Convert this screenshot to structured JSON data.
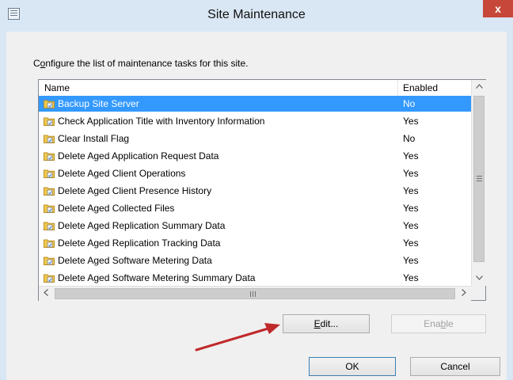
{
  "window": {
    "title": "Site Maintenance",
    "close_label": "x",
    "icon": "dialog-icon"
  },
  "instruction": {
    "accel": "o",
    "prefix": "C",
    "rest": "nfigure the list of maintenance tasks for this site."
  },
  "list": {
    "columns": {
      "name": "Name",
      "enabled": "Enabled"
    },
    "rows": [
      {
        "name": "Backup Site Server",
        "enabled": "No",
        "selected": true
      },
      {
        "name": "Check Application Title with Inventory Information",
        "enabled": "Yes"
      },
      {
        "name": "Clear Install Flag",
        "enabled": "No"
      },
      {
        "name": "Delete Aged Application Request Data",
        "enabled": "Yes"
      },
      {
        "name": "Delete Aged Client Operations",
        "enabled": "Yes"
      },
      {
        "name": "Delete Aged Client Presence History",
        "enabled": "Yes"
      },
      {
        "name": "Delete Aged Collected Files",
        "enabled": "Yes"
      },
      {
        "name": "Delete Aged Replication Summary Data",
        "enabled": "Yes"
      },
      {
        "name": "Delete Aged Replication Tracking Data",
        "enabled": "Yes"
      },
      {
        "name": "Delete Aged Software Metering Data",
        "enabled": "Yes"
      },
      {
        "name": "Delete Aged Software Metering Summary Data",
        "enabled": "Yes"
      }
    ]
  },
  "scrollbar": {
    "up_glyph": "^",
    "down_glyph": "v",
    "left_glyph": "<",
    "right_glyph": ">",
    "grip_glyph": "III"
  },
  "buttons": {
    "edit": {
      "accel": "E",
      "rest": "dit..."
    },
    "enable": {
      "pre": "Ena",
      "accel": "b",
      "post": "le"
    },
    "ok": "OK",
    "cancel": "Cancel"
  },
  "colors": {
    "selection": "#3399ff",
    "annotation_arrow": "#c0282a"
  }
}
